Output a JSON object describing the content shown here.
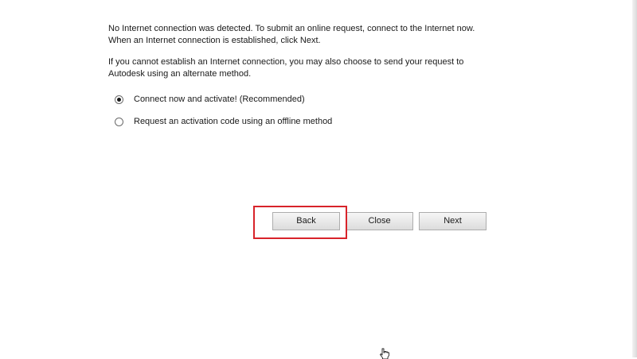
{
  "message": {
    "line1": "No Internet connection was detected. To submit an online request, connect to the Internet now.",
    "line2": "When an Internet connection is established, click Next.",
    "line3": "If you cannot establish an Internet connection, you may also choose to send your request to",
    "line4": "Autodesk using an alternate method."
  },
  "options": [
    {
      "label": "Connect now and activate! (Recommended)",
      "selected": true
    },
    {
      "label": "Request an activation code using an offline method",
      "selected": false
    }
  ],
  "buttons": {
    "back_label": "Back",
    "close_label": "Close",
    "next_label": "Next"
  },
  "colors": {
    "highlight": "#d8232a"
  },
  "icons": {
    "cursor": "hand-pointer-icon"
  }
}
